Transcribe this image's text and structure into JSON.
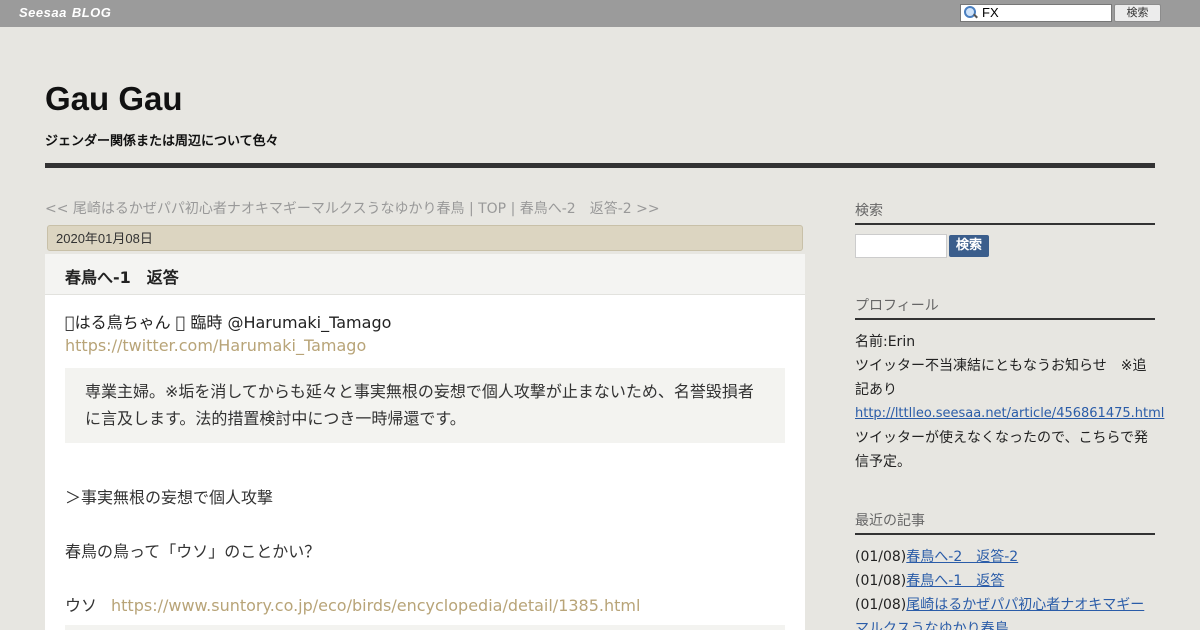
{
  "topbar": {
    "brand_left": "Seesaa",
    "brand_right": "BLOG",
    "search_value": "FX",
    "search_button": "検索"
  },
  "header": {
    "title": "Gau Gau",
    "description": "ジェンダー関係または周辺について色々"
  },
  "nav": {
    "text": "<< 尾崎はるかぜパパ初心者ナオキマギーマルクスうなゆかり春鳥 | TOP | 春鳥へ-2　返答-2 >>"
  },
  "article": {
    "date": "2020年01月08日",
    "title": "春鳥へ-1　返答",
    "author_line": "\u0000はる鳥ちゃん \u0000 臨時 @Harumaki_Tamago",
    "author_link": "https://twitter.com/Harumaki_Tamago",
    "quote": "専業主婦。※垢を消してからも延々と事実無根の妄想で個人攻撃が止まないため、名誉毀損者に言及します。法的措置検討中につき一時帰還です。",
    "para1": "＞事実無根の妄想で個人攻撃",
    "para2": "春鳥の鳥って「ウソ」のことかい？",
    "para3_label": "ウソ",
    "para3_link": "https://www.suntory.co.jp/eco/birds/encyclopedia/detail/1385.html"
  },
  "sidebar": {
    "search_heading": "検索",
    "search_button": "検索",
    "profile_heading": "プロフィール",
    "profile_name": "名前:Erin",
    "profile_text1": "ツイッター不当凍結にともなうお知らせ　※追記あり",
    "profile_link": "http://lttlleo.seesaa.net/article/456861475.html",
    "profile_text2": "ツイッターが使えなくなったので、こちらで発信予定。",
    "recent_heading": "最近の記事",
    "recent": [
      {
        "date": "(01/08)",
        "title": "春鳥へ-2　返答-2"
      },
      {
        "date": "(01/08)",
        "title": "春鳥へ-1　返答"
      },
      {
        "date": "(01/08)",
        "title": "尾崎はるかぜパパ初心者ナオキマギーマルクスうなゆかり春鳥"
      }
    ]
  }
}
